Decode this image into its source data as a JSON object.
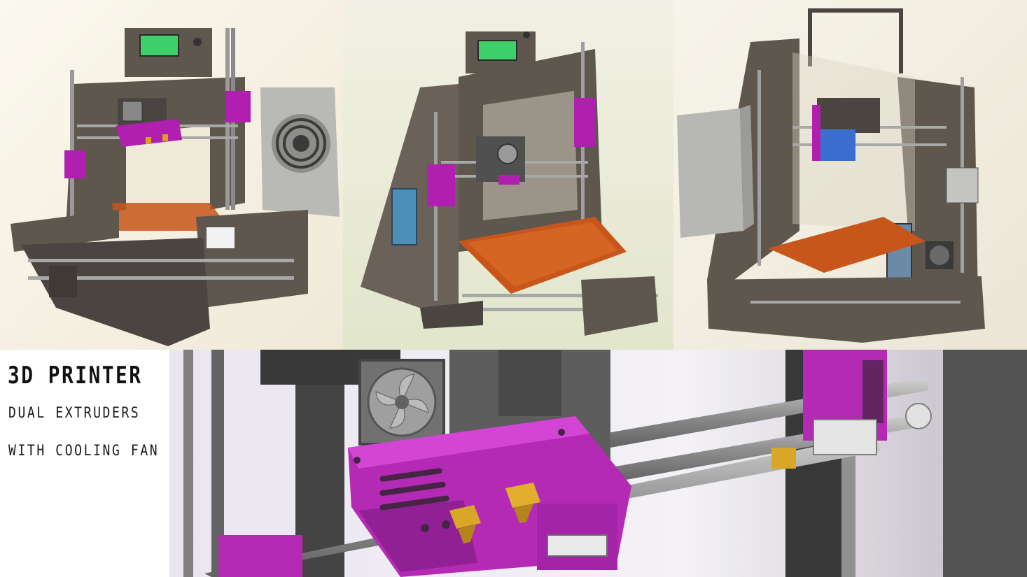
{
  "caption": {
    "title": "3D PRINTER",
    "line1": "DUAL EXTRUDERS",
    "line2": "WITH COOLING FAN"
  },
  "colors": {
    "frame": "#5e574e",
    "frame_dark": "#3f3a34",
    "bracket": "#b01fb0",
    "bed": "#c8561a",
    "lcd": "#3fd06a",
    "rod": "#9a9a9a",
    "nozzle": "#d9a21c"
  },
  "icons": [
    "cooling-fan-icon",
    "lcd-screen-icon",
    "power-supply-icon"
  ]
}
